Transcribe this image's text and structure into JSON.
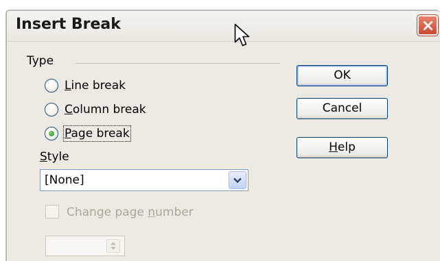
{
  "dialog": {
    "title": "Insert Break",
    "close_icon": "close-x-icon"
  },
  "type_group": {
    "label": "Type",
    "options": [
      {
        "label_access": "L",
        "label_rest": "ine break",
        "selected": false
      },
      {
        "label_access": "C",
        "label_rest": "olumn break",
        "selected": false
      },
      {
        "label_access": "P",
        "label_rest": "age break",
        "selected": true
      }
    ]
  },
  "style": {
    "label_access": "S",
    "label_rest": "tyle",
    "selected_value": "[None]"
  },
  "change_page_number": {
    "label_before": "Change page ",
    "label_access": "n",
    "label_after": "umber",
    "checked": false,
    "enabled": false
  },
  "buttons": {
    "ok": "OK",
    "cancel": "Cancel",
    "help_access": "H",
    "help_rest": "elp"
  },
  "colors": {
    "dialog_bg": "#eceae2",
    "close_red": "#c9492f",
    "button_border": "#003c74",
    "disabled_text": "#aca899"
  }
}
